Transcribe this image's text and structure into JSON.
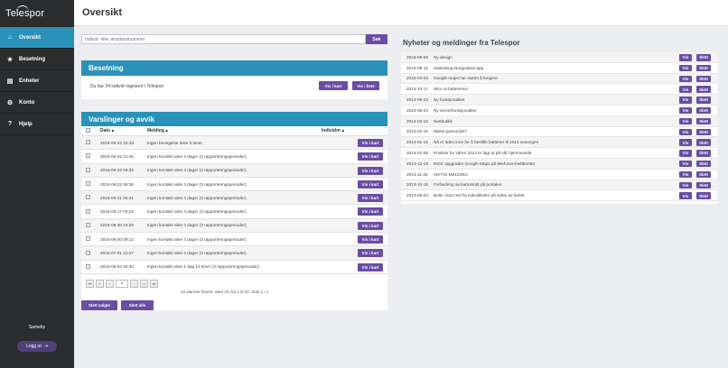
{
  "app": {
    "logo": "Telespor",
    "page_title": "Oversikt"
  },
  "sidebar": {
    "items": [
      {
        "label": "Oversikt",
        "icon": "home-icon",
        "glyph": "⌂"
      },
      {
        "label": "Besetning",
        "icon": "star-icon",
        "glyph": "★"
      },
      {
        "label": "Enheter",
        "icon": "devices-icon",
        "glyph": "▤"
      },
      {
        "label": "Konto",
        "icon": "gear-icon",
        "glyph": "⚙"
      },
      {
        "label": "Hjelp",
        "icon": "help-icon",
        "glyph": "?"
      }
    ],
    "user": "Sameby",
    "logout_label": "Logg ut"
  },
  "search": {
    "placeholder": "Individ- eller øreplommummer",
    "button": "Søk"
  },
  "besetning": {
    "title": "Besetning",
    "text": "Du har 24 individ registrert i Telespor",
    "btn_map": "Vis i kart",
    "btn_list": "Vis i liste"
  },
  "varslinger": {
    "title": "Varslinger og avvik",
    "columns": {
      "date": "Dato ▴",
      "message": "Melding ▴",
      "individ": "Individnr ▴"
    },
    "row_button": "Vis i kart",
    "rows": [
      {
        "date": "2016-09-22 22:48",
        "message": "Ingen bevegelse siste 3 timer."
      },
      {
        "date": "2016-05-22 21:46",
        "message": "Ingen kontakt siste 3 dager (3 rapporteringsperioder)."
      },
      {
        "date": "2016-09-22 09:32",
        "message": "Ingen kontakt siste 3 dager (3 rapporteringsperioder)."
      },
      {
        "date": "2016-09-22 08:36",
        "message": "Ingen kontakt siste 3 dager (3 rapporteringsperioder)."
      },
      {
        "date": "2016-09-21 05:31",
        "message": "Ingen kontakt siste 3 dager (3 rapporteringsperioder)."
      },
      {
        "date": "2016-05-17 03:22",
        "message": "Ingen kontakt siste 3 dager (3 rapporteringsperioder)."
      },
      {
        "date": "2016-08-30 15:26",
        "message": "Ingen kontakt siste 3 dager (3 rapporteringsperioder)."
      },
      {
        "date": "2016-08-30 09:12",
        "message": "Ingen kontakt siste 3 dager (3 rapporteringsperioder)."
      },
      {
        "date": "2016-07-01 21:27",
        "message": "Ingen kontakt siste 3 dager (3 rapporteringsperioder)."
      },
      {
        "date": "2016-05-04 20:40",
        "message": "Ingen kontakt siste 1 dag 12 timer (3 rapporteringsperioder)."
      }
    ],
    "pager": {
      "first": "⏮",
      "prev_fast": "«",
      "prev": "‹",
      "page": "1",
      "next": "›",
      "next_fast": "»",
      "last": "⏭"
    },
    "pager_info": "10 alarmer funnet, viser 10, fra 1 til 10. Side 1 / 1",
    "delete_selected": "Slett valgte",
    "delete_all": "Slett alle"
  },
  "news": {
    "title": "Nyheter og meldinger fra Telespor",
    "vis_label": "Vis",
    "slett_label": "Slett",
    "items": [
      {
        "date": "2016-09-06",
        "title": "Ny design"
      },
      {
        "date": "2016-08-12",
        "title": "Veiledning Norgeskart-app"
      },
      {
        "date": "2015-03-04",
        "title": "Google maps har sluttet å fungere"
      },
      {
        "date": "2014-10-17",
        "title": "Skru ut batteriene!"
      },
      {
        "date": "2014-05-23",
        "title": "Ny funksjonalitet"
      },
      {
        "date": "2014-06-23",
        "title": "Ny serverfunksjonalitet"
      },
      {
        "date": "2014-03-10",
        "title": "Nettbutikk"
      },
      {
        "date": "2014-02-10",
        "title": "Mistet passordet?"
      },
      {
        "date": "2014-01-15",
        "title": "Nå er tiden inne for å bestille batterier til 2014 sesongen"
      },
      {
        "date": "2014-01-08",
        "title": "Prisliste for våren 2014 er lagt ut på vår hjemmeside"
      },
      {
        "date": "2013-12-19",
        "title": "IKKE oppgrader Google Maps på telefonen/nettbrettet"
      },
      {
        "date": "2013-11-25",
        "title": "VIKTIG MELDING"
      },
      {
        "date": "2013-10-15",
        "title": "Forbedring av kartutsnitt på portalen"
      },
      {
        "date": "2013-09-23",
        "title": "Bolle i kart rett fra individlisten på siden av kartet"
      }
    ]
  }
}
